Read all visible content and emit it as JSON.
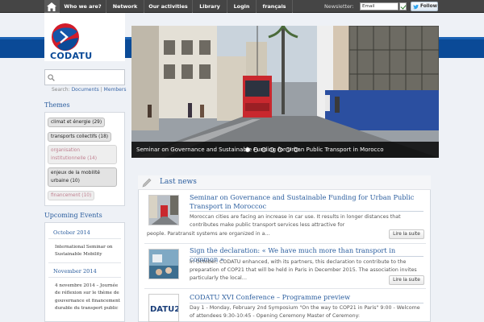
{
  "nav": {
    "items": [
      {
        "label": "Who we are?"
      },
      {
        "label": "Network"
      },
      {
        "label": "Our activities"
      },
      {
        "label": "Library"
      },
      {
        "label": "Login"
      },
      {
        "label": "français"
      }
    ],
    "newsletter_label": "Newsletter:",
    "newsletter_value": "Email",
    "follow_label": "Follow"
  },
  "brand": {
    "name": "CODATU"
  },
  "search": {
    "placeholder": "",
    "hint_prefix": "Search:",
    "hint_documents": "Documents",
    "hint_sep": "|",
    "hint_members": "Members"
  },
  "themes": {
    "heading": "Themes",
    "tags": [
      {
        "label": "climat et énergie (29)"
      },
      {
        "label": "transports collectifs (18)"
      },
      {
        "label": "organisation institutionnelle (14)"
      },
      {
        "label": "enjeux de la mobilité urbaine (10)"
      },
      {
        "label": "financement (10)"
      }
    ]
  },
  "events": {
    "heading": "Upcoming Events",
    "groups": [
      {
        "month": "October 2014",
        "text": "International Seminar on Sustainable Mobility"
      },
      {
        "month": "November 2014",
        "text": "4 novembre 2014 – Journée de réflexion sur le thème de gouvernance et financement durable du transport public"
      }
    ]
  },
  "slider": {
    "caption": "Seminar on Governance and Sustainable Funding  for Urban Public Transport in Morocco",
    "active_slide": 1
  },
  "news": {
    "heading": "Last news",
    "more_label": "Lire la suite",
    "items": [
      {
        "title": "Seminar on Governance and Sustainable Funding for Urban Public Transport in Moroccoc",
        "body_right": "Moroccan cities are facing an increase in car use. It results in longer distances that contributes make public transport services less attractive for",
        "body_full": "people. Paratransit systems are organized in a…"
      },
      {
        "title": "Sign the declaration: « We have much more than transport in common »",
        "body_right": "In October, CODATU enhanced, with its partners, this declaration to contribute to the preparation of COP21 that will be held in Paris in December 2015. The association invites particularly the local…",
        "body_full": ""
      },
      {
        "title": "CODATU XVI Conference – Programme preview",
        "body_right": "Day 1 - Monday, February 2nd Symposium \"On the way to COP21 in Paris\" 9:00 - Welcome of attendees 9:30-10:45 - Opening Ceremony Master of Ceremony:",
        "body_full": "",
        "thumb_text": "DATU20"
      }
    ]
  },
  "colors": {
    "brand_blue": "#0a4a97",
    "link_blue": "#2a5d9e",
    "nav_bg": "#454545"
  }
}
